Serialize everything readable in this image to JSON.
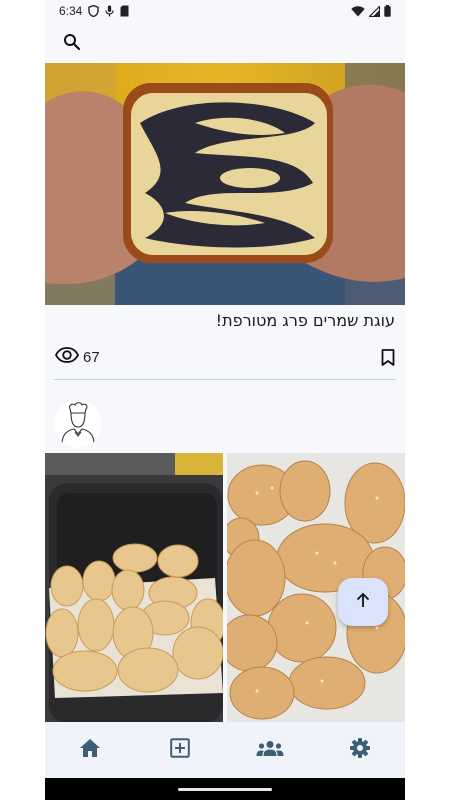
{
  "status_bar": {
    "time": "6:34",
    "icons": [
      "shield-icon",
      "mic-icon",
      "sim-card-icon"
    ],
    "right_icons": [
      "wifi-icon",
      "signal-icon",
      "battery-icon"
    ]
  },
  "top_bar": {
    "search_icon": "search-icon"
  },
  "feed": {
    "post_1": {
      "title": "עוגת שמרים פרג מטורפת!",
      "views": "67",
      "views_icon": "eye-icon",
      "bookmark_icon": "bookmark-icon"
    },
    "post_2": {
      "avatar_icon": "chef-avatar-icon"
    }
  },
  "fab": {
    "icon": "arrow-up-icon"
  },
  "bottom_nav": {
    "items": [
      "home-icon",
      "add-box-icon",
      "groups-icon",
      "settings-icon"
    ],
    "color": "#3d5f73"
  },
  "colors": {
    "background": "#f7f8fc",
    "fab": "#d9e3fb",
    "divider": "#b8d6d6",
    "nav_icon": "#3d5f73"
  }
}
